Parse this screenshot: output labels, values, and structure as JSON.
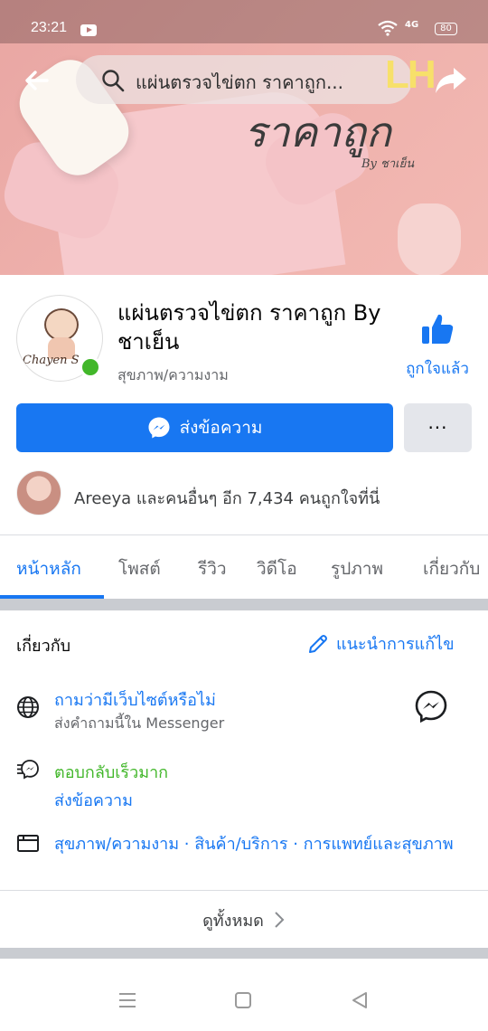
{
  "status_bar": {
    "time": "23:21",
    "network": "4G",
    "battery": "80"
  },
  "cover": {
    "search_text": "แผ่นตรวจไข่ตก ราคาถูก...",
    "brand_script": "ราคาถูก",
    "brand_by": "By ชาเย็น",
    "lh_logo": "LH"
  },
  "page": {
    "name": "แผ่นตรวจไข่ตก ราคาถูก By ชาเย็น",
    "category": "สุขภาพ/ความงาม",
    "avatar_signature": "Chayen S",
    "liked_label": "ถูกใจแล้ว",
    "message_button": "ส่งข้อความ",
    "more_button": "···",
    "likes_summary": "Areeya และคนอื่นๆ อีก 7,434 คนถูกใจที่นี่"
  },
  "tabs": [
    {
      "label": "หน้าหลัก",
      "active": true
    },
    {
      "label": "โพสต์",
      "active": false
    },
    {
      "label": "รีวิว",
      "active": false
    },
    {
      "label": "วิดีโอ",
      "active": false
    },
    {
      "label": "รูปภาพ",
      "active": false
    },
    {
      "label": "เกี่ยวกับ",
      "active": false
    }
  ],
  "about": {
    "title": "เกี่ยวกับ",
    "edit_link": "แนะนำการแก้ไข",
    "website_link": "ถามว่ามีเว็บไซต์หรือไม่",
    "website_sub": "ส่งคำถามนี้ใน Messenger",
    "response_speed": "ตอบกลับเร็วมาก",
    "send_message": "ส่งข้อความ",
    "categories": "สุขภาพ/ความงาม · สินค้า/บริการ · การแพทย์และสุขภาพ",
    "see_all": "ดูทั้งหมด"
  },
  "colors": {
    "accent": "#1877f2",
    "green": "#42b72a",
    "secondary_text": "#65676b"
  }
}
